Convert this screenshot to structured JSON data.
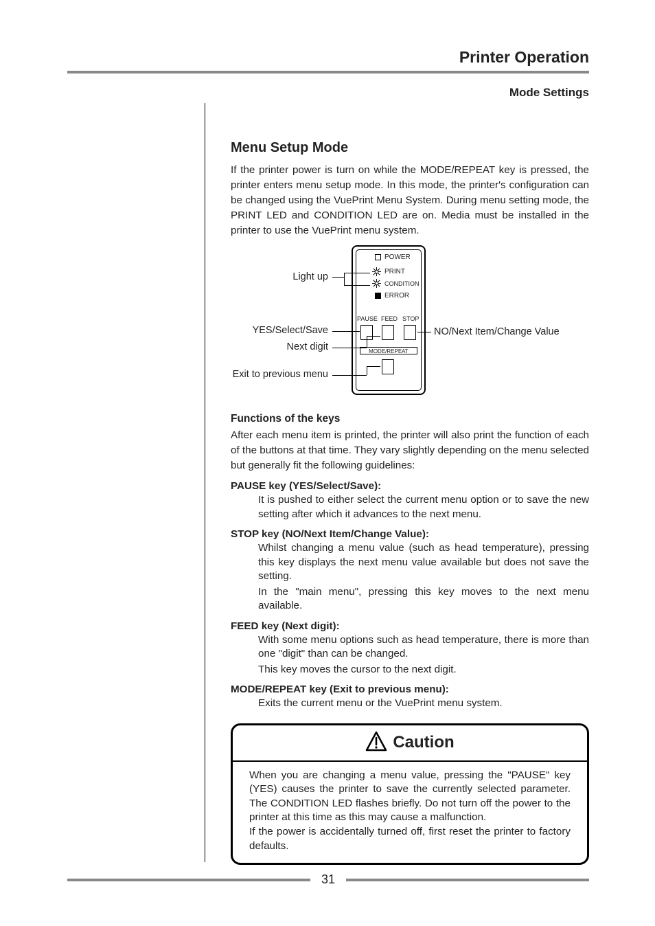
{
  "header": {
    "chapter": "Printer Operation",
    "section": "Mode Settings"
  },
  "subsection_title": "Menu Setup Mode",
  "intro": "If the printer power is turn on while the MODE/REPEAT key is pressed, the printer enters menu setup mode. In this mode, the printer's configuration can be changed using the VuePrint Menu System.  During menu setting mode, the PRINT LED and CONDITION LED are on.  Media must be installed in the printer to use the VuePrint menu system.",
  "diagram": {
    "leds": {
      "power": "POWER",
      "print": "PRINT",
      "condition": "CONDITION",
      "error": "ERROR"
    },
    "key_labels": {
      "pause": "PAUSE",
      "feed": "FEED",
      "stop": "STOP",
      "mode_repeat": "MODE/REPEAT"
    },
    "callouts": {
      "light_up": "Light up",
      "yes_select_save": "YES/Select/Save",
      "next_digit": "Next digit",
      "exit_prev": "Exit to previous menu",
      "no_next": "NO/Next Item/Change Value"
    }
  },
  "functions_heading": "Functions of the keys",
  "functions_intro": "After each menu item is printed, the printer will also print the function of each of the buttons at that time.  They vary slightly depending on the menu selected but generally fit the following  guidelines:",
  "keys": [
    {
      "title": "PAUSE key (YES/Select/Save):",
      "paras": [
        "It is pushed to either select the current menu option or to save the new setting after which it advances to the next menu."
      ]
    },
    {
      "title": "STOP key (NO/Next Item/Change Value):",
      "paras": [
        "Whilst changing a menu value (such as head temperature), pressing this key displays the next menu value available but does not save the setting.",
        "In the \"main menu\", pressing this key moves to the next menu available."
      ]
    },
    {
      "title": "FEED key (Next digit):",
      "paras": [
        "With some menu options such as head temperature, there is more than one \"digit\" than can be changed.",
        "This key moves the  cursor to the next digit."
      ]
    },
    {
      "title": "MODE/REPEAT key (Exit to previous menu):",
      "paras": [
        "Exits the current menu or the VuePrint menu system."
      ]
    }
  ],
  "caution": {
    "title": "Caution",
    "para1": "When you are changing a menu value, pressing the \"PAUSE\" key (YES) causes the printer to save the currently selected parameter. The CONDITION LED flashes briefly. Do not turn off the power to the printer at this time as this may cause a malfunction.",
    "para2": "If the power is accidentally turned off, first reset the printer to factory defaults."
  },
  "page_number": "31"
}
